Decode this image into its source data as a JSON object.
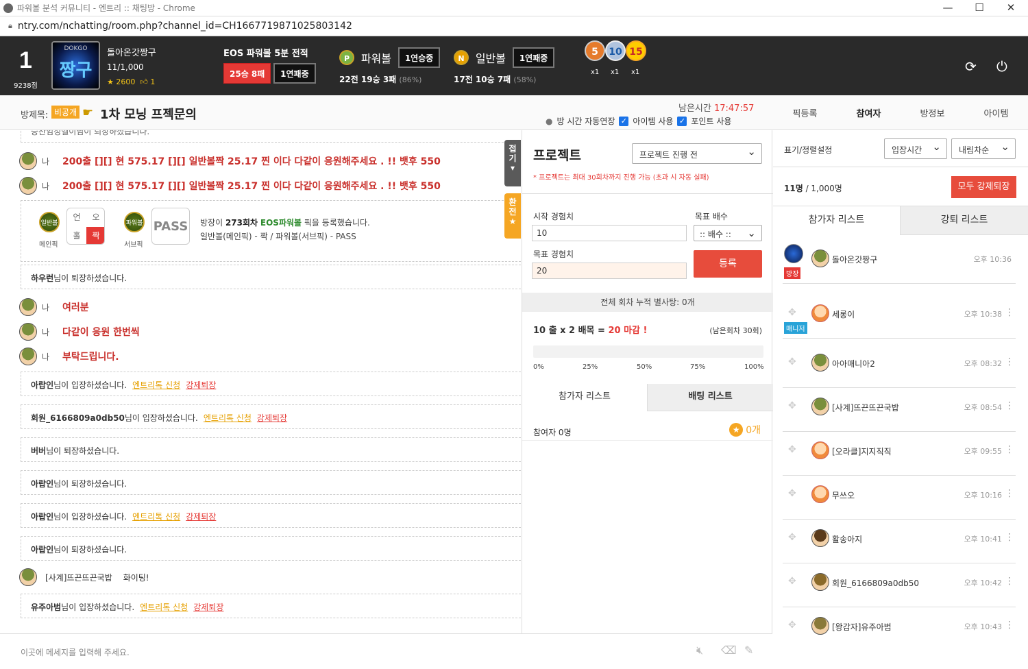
{
  "window": {
    "title": "파워볼 분석 커뮤니티 - 엔트리 :: 채팅방 - Chrome",
    "url": "ntry.com/nchatting/room.php?channel_id=CH1667719871025803142"
  },
  "header": {
    "rank": "1",
    "points": "9238점",
    "avatar_top": "DOKGO",
    "avatar_text": "짱구",
    "user_name": "돌아온갓짱구",
    "user_level": "11/1,000",
    "stars": "2600",
    "likes": "1",
    "eos_title": "EOS 파워볼 5분 전적",
    "eos_record": "25승 8패",
    "eos_streak": "1연패중",
    "powerball_label": "파워볼",
    "powerball_streak": "1연승중",
    "powerball_stats": "22전 19승 3패",
    "powerball_pct": "(86%)",
    "normal_label": "일반볼",
    "normal_streak": "1연패중",
    "normal_stats": "17전 10승 7패",
    "normal_pct": "(58%)",
    "medals": [
      {
        "n": "5",
        "x": "x1"
      },
      {
        "n": "10",
        "x": "x1"
      },
      {
        "n": "15",
        "x": "x1"
      }
    ]
  },
  "room": {
    "label": "방제목:",
    "private_badge": "비공개",
    "title": "1차 모닝 프젝문의",
    "remaining_label": "남은시간",
    "remaining_time": "17:47:57",
    "opt_auto": "방 시간 자동연장",
    "opt_item": "아이템 사용",
    "opt_point": "포인트 사용",
    "tabs": [
      "픽등록",
      "참여자",
      "방정보",
      "아이템"
    ]
  },
  "chat": {
    "cut_top": "승찬임정헬이님이 퇴장하셨습니다.",
    "me": "나",
    "msg1": "200출 [][] 현 575.17 [][] 일반볼짝 25.17 찐 이다 다같이 응원해주세요 . !! 뱃후 550",
    "msg2": "200출 [][] 현 575.17 [][] 일반볼짝 25.17 찐 이다 다같이 응원해주세요 . !! 뱃후 550",
    "pick": {
      "main_ball": "일반볼",
      "main_cap": "메인픽",
      "grid": [
        "언",
        "오",
        "홀",
        "짝"
      ],
      "sub_ball": "파워볼",
      "sub_cap": "서브픽",
      "pass": "PASS",
      "line1_a": "방장이 ",
      "line1_round": "273회차",
      "line1_game": "EOS파워볼",
      "line1_b": " 픽을 등록했습니다.",
      "line2": "일반볼(메인픽) - 짝 / 파워볼(서브픽) - PASS"
    },
    "sys1_name": "하우런",
    "left_suffix": "님이 퇴장하셨습니다.",
    "join_suffix": "님이 입장하셨습니다.",
    "msg3": "여러분",
    "msg4": "다같이 응원 한번씩",
    "msg5": "부탁드립니다.",
    "sys2_name": "아랍인",
    "sys3_name": "회원_6166809a0db50",
    "sys4_name": "버버",
    "sys5_name": "아랍인",
    "sys6_name": "아랍인",
    "sys7_name": "아랍인",
    "sys8_user": "[사계]뜨끈뜨끈국밥",
    "sys8_msg": "화이팅!",
    "sys9_name": "유주아범",
    "apply": "엔트리톡 신청",
    "kick": "강제퇴장",
    "side_fold": "접기",
    "side_toggle": "환전",
    "input_placeholder": "이곳에 메세지를 입력해 주세요."
  },
  "project": {
    "title": "프로젝트",
    "status": "프로젝트 진행 전",
    "note": "* 프로젝트는 최대 30회차까지 진행 가능 (초과 시 자동 실패)",
    "start_label": "시작 경험치",
    "start_value": "10",
    "mult_label": "목표 배수",
    "mult_value": ":: 배수 ::",
    "target_label": "목표 경험치",
    "target_value": "20",
    "register": "등록",
    "cumulative": "전체 회차 누적 별사탕: 0개",
    "calc_a": "10 출 x 2 배목 = ",
    "calc_b": "20 마감 !",
    "remaining": "(남은회차 30회)",
    "progress": 0,
    "progress_labels": [
      "0%",
      "25%",
      "50%",
      "75%",
      "100%"
    ],
    "tab_participants": "참가자 리스트",
    "tab_betting": "배팅 리스트",
    "participant_count": "참여자 0명",
    "points": "0개"
  },
  "right": {
    "sort_label": "표기/정렬설정",
    "sort_by": "입장시간",
    "sort_order": "내림차순",
    "count_a": "11명",
    "count_b": " / 1,000명",
    "kick_all": "모두 강제퇴장",
    "tab_participants": "참가자 리스트",
    "tab_kicked": "강퇴 리스트",
    "users": [
      {
        "name": "돌아온갓짱구",
        "time": "오후 10:36",
        "badge": "방장"
      },
      {
        "name": "세롱이",
        "time": "오후 10:38",
        "badge": "매니저"
      },
      {
        "name": "아아매니아2",
        "time": "오후 08:32",
        "badge": ""
      },
      {
        "name": "[사계]뜨끈뜨끈국밥",
        "time": "오후 08:54",
        "badge": ""
      },
      {
        "name": "[오라클]지지직직",
        "time": "오후 09:55",
        "badge": ""
      },
      {
        "name": "무쓰오",
        "time": "오후 10:16",
        "badge": ""
      },
      {
        "name": "활송아지",
        "time": "오후 10:41",
        "badge": ""
      },
      {
        "name": "회원_6166809a0db50",
        "time": "오후 10:42",
        "badge": ""
      },
      {
        "name": "[왕감자]유주아범",
        "time": "오후 10:43",
        "badge": ""
      }
    ]
  }
}
